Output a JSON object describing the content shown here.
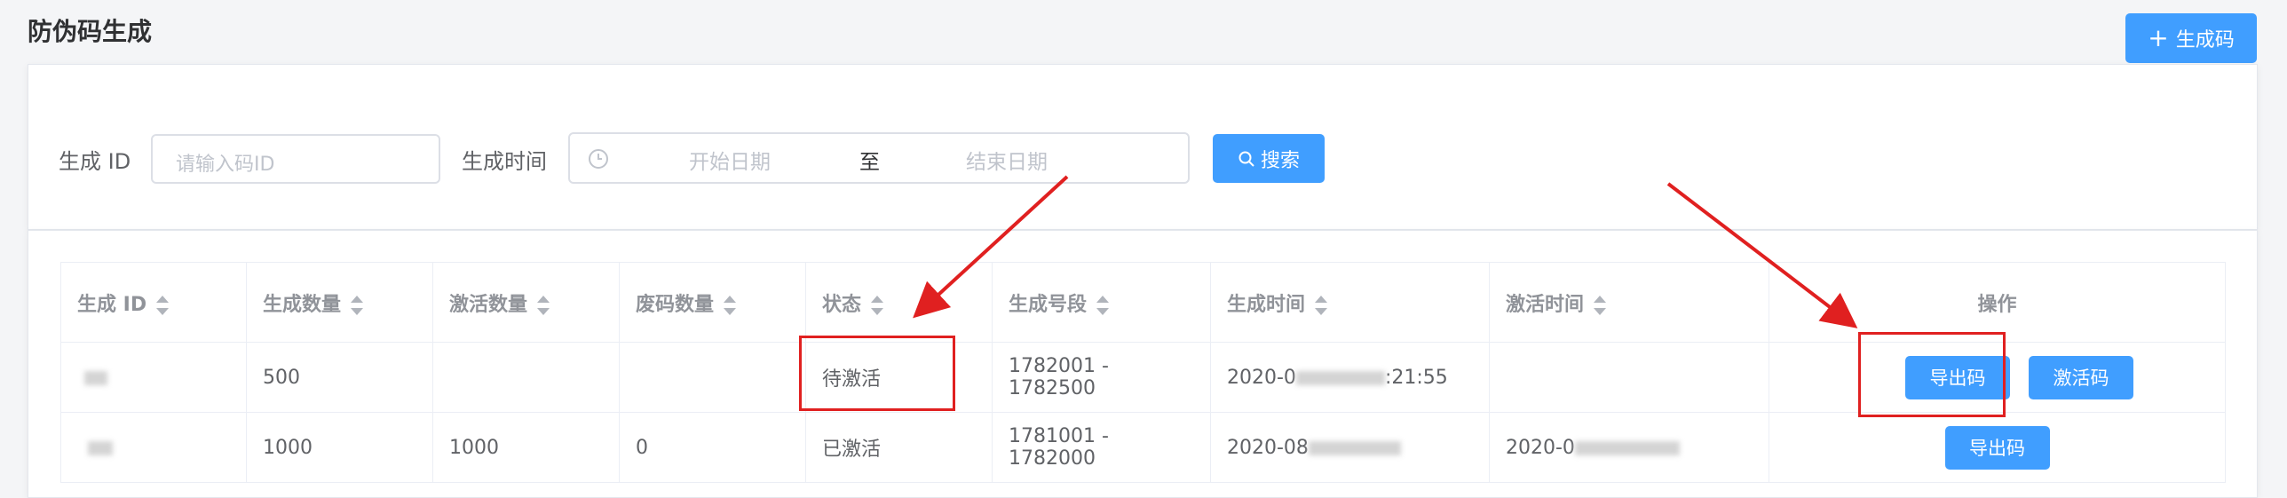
{
  "page": {
    "title": "防伪码生成"
  },
  "header": {
    "generate_button": "生成码",
    "plus_icon": "plus-icon"
  },
  "search": {
    "id_label": "生成 ID",
    "id_placeholder": "请输入码ID",
    "time_label": "生成时间",
    "start_placeholder": "开始日期",
    "range_separator": "至",
    "end_placeholder": "结束日期",
    "search_button": "搜索",
    "clock_icon": "clock-icon",
    "search_icon": "search-icon"
  },
  "table": {
    "columns": [
      "生成 ID",
      "生成数量",
      "激活数量",
      "废码数量",
      "状态",
      "生成号段",
      "生成时间",
      "激活时间",
      "操作"
    ],
    "rows": [
      {
        "qty": "500",
        "activated": "",
        "void": "",
        "status": "待激活",
        "range": "1782001 - 1782500",
        "gen_time_prefix": "2020-0",
        "gen_time_suffix": ":21:55",
        "act_time_prefix": "",
        "actions": [
          "导出码",
          "激活码"
        ]
      },
      {
        "qty": "1000",
        "activated": "1000",
        "void": "0",
        "status": "已激活",
        "range": "1781001 - 1782000",
        "gen_time_prefix": "2020-08",
        "gen_time_suffix": "",
        "act_time_prefix": "2020-0",
        "actions": [
          "导出码"
        ]
      }
    ]
  },
  "colors": {
    "primary": "#409eff",
    "annotation": "#e02020"
  }
}
